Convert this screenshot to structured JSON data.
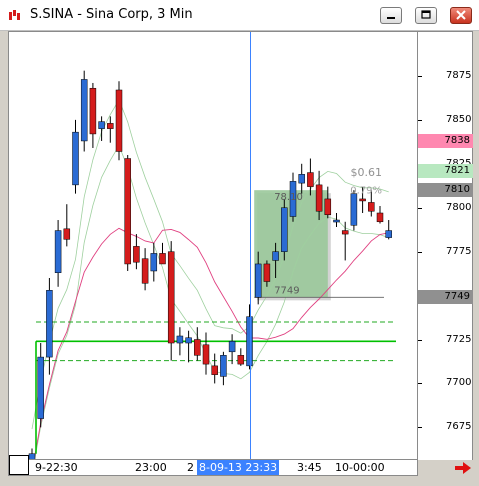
{
  "window": {
    "title": "S.SINA - Sina Corp, 3 Min",
    "app_icon": "chart-app-icon",
    "buttons": [
      "minimize-icon",
      "maximize-icon",
      "close-icon"
    ]
  },
  "price_axis": {
    "ticks": [
      "7875",
      "7850",
      "7825",
      "7800",
      "7775",
      "7750",
      "7725",
      "7700",
      "7675"
    ],
    "badges": [
      {
        "label": "7838",
        "color": "#ff88b0"
      },
      {
        "label": "7821",
        "color": "#b8e8c0"
      },
      {
        "label": "7810",
        "color": "#909090"
      },
      {
        "label": "7749",
        "color": "#909090"
      }
    ]
  },
  "time_axis": {
    "labels": [
      "9-22:30",
      "23:00",
      "2",
      "3:45",
      "10-00:00"
    ],
    "cursor_label": "8-09-13 23:33"
  },
  "measure_tool": {
    "start_price": "7749",
    "end_price": "78.10",
    "change": "$0.61",
    "pct": "0.79%"
  },
  "chart_data": {
    "type": "candlestick",
    "ylim": [
      7657,
      7900
    ],
    "candles": [
      {
        "o": 7655,
        "h": 7663,
        "l": 7645,
        "c": 7660,
        "up": true
      },
      {
        "o": 7680,
        "h": 7723,
        "l": 7675,
        "c": 7715,
        "up": true
      },
      {
        "o": 7715,
        "h": 7760,
        "l": 7705,
        "c": 7753,
        "up": true
      },
      {
        "o": 7763,
        "h": 7793,
        "l": 7755,
        "c": 7787,
        "up": true
      },
      {
        "o": 7788,
        "h": 7802,
        "l": 7778,
        "c": 7782,
        "up": false
      },
      {
        "o": 7813,
        "h": 7850,
        "l": 7808,
        "c": 7843,
        "up": true
      },
      {
        "o": 7838,
        "h": 7878,
        "l": 7832,
        "c": 7873,
        "up": true
      },
      {
        "o": 7868,
        "h": 7871,
        "l": 7834,
        "c": 7842,
        "up": false
      },
      {
        "o": 7845,
        "h": 7852,
        "l": 7838,
        "c": 7849,
        "up": true
      },
      {
        "o": 7848,
        "h": 7852,
        "l": 7837,
        "c": 7845,
        "up": false
      },
      {
        "o": 7867,
        "h": 7872,
        "l": 7827,
        "c": 7832,
        "up": false
      },
      {
        "o": 7828,
        "h": 7830,
        "l": 7764,
        "c": 7768,
        "up": false
      },
      {
        "o": 7778,
        "h": 7785,
        "l": 7765,
        "c": 7769,
        "up": false
      },
      {
        "o": 7771,
        "h": 7777,
        "l": 7753,
        "c": 7757,
        "up": false
      },
      {
        "o": 7764,
        "h": 7780,
        "l": 7758,
        "c": 7774,
        "up": true
      },
      {
        "o": 7774,
        "h": 7780,
        "l": 7768,
        "c": 7768,
        "up": false
      },
      {
        "o": 7775,
        "h": 7781,
        "l": 7713,
        "c": 7723,
        "up": false
      },
      {
        "o": 7723,
        "h": 7732,
        "l": 7716,
        "c": 7727,
        "up": true
      },
      {
        "o": 7723,
        "h": 7730,
        "l": 7712,
        "c": 7726,
        "up": true
      },
      {
        "o": 7725,
        "h": 7732,
        "l": 7713,
        "c": 7716,
        "up": false
      },
      {
        "o": 7722,
        "h": 7729,
        "l": 7705,
        "c": 7711,
        "up": false
      },
      {
        "o": 7705,
        "h": 7717,
        "l": 7700,
        "c": 7710,
        "up": false
      },
      {
        "o": 7704,
        "h": 7718,
        "l": 7699,
        "c": 7716,
        "up": true
      },
      {
        "o": 7718,
        "h": 7728,
        "l": 7711,
        "c": 7724,
        "up": true
      },
      {
        "o": 7716,
        "h": 7720,
        "l": 7710,
        "c": 7711,
        "up": false
      },
      {
        "o": 7710,
        "h": 7745,
        "l": 7708,
        "c": 7738,
        "up": true
      },
      {
        "o": 7749,
        "h": 7775,
        "l": 7745,
        "c": 7768,
        "up": true
      },
      {
        "o": 7768,
        "h": 7770,
        "l": 7755,
        "c": 7758,
        "up": false
      },
      {
        "o": 7770,
        "h": 7780,
        "l": 7760,
        "c": 7775,
        "up": true
      },
      {
        "o": 7775,
        "h": 7805,
        "l": 7770,
        "c": 7800,
        "up": true
      },
      {
        "o": 7795,
        "h": 7820,
        "l": 7792,
        "c": 7815,
        "up": true
      },
      {
        "o": 7814,
        "h": 7825,
        "l": 7808,
        "c": 7819,
        "up": true
      },
      {
        "o": 7820,
        "h": 7828,
        "l": 7807,
        "c": 7812,
        "up": false
      },
      {
        "o": 7813,
        "h": 7821,
        "l": 7793,
        "c": 7798,
        "up": false
      },
      {
        "o": 7805,
        "h": 7812,
        "l": 7794,
        "c": 7796,
        "up": false
      },
      {
        "o": 7792,
        "h": 7797,
        "l": 7789,
        "c": 7793,
        "up": true
      },
      {
        "o": 7787,
        "h": 7792,
        "l": 7770,
        "c": 7785,
        "up": false
      },
      {
        "o": 7790,
        "h": 7810,
        "l": 7787,
        "c": 7808,
        "up": true
      },
      {
        "o": 7805,
        "h": 7812,
        "l": 7797,
        "c": 7804,
        "up": false
      },
      {
        "o": 7803,
        "h": 7810,
        "l": 7795,
        "c": 7798,
        "up": false
      },
      {
        "o": 7797,
        "h": 7801,
        "l": 7791,
        "c": 7792,
        "up": false
      },
      {
        "o": 7787,
        "h": 7793,
        "l": 7782,
        "c": 7783,
        "up": true
      }
    ],
    "horizontal_lines": [
      {
        "value": 7735,
        "color": "#22aa22",
        "style": "dashed"
      },
      {
        "value": 7724,
        "color": "#00c000",
        "style": "solid"
      },
      {
        "value": 7713,
        "color": "#22aa22",
        "style": "dashed"
      }
    ],
    "colors": {
      "up": "#2a6bd4",
      "down": "#d41c1c",
      "ma": "#e04080",
      "band": "#9ac89a",
      "cursor": "#3b82ff"
    }
  }
}
